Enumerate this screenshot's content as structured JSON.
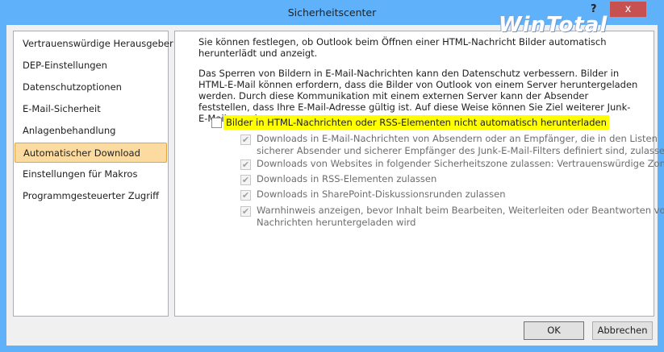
{
  "window": {
    "title": "Sicherheitscenter",
    "help": "?",
    "close": "x",
    "watermark": "WinTotal"
  },
  "sidebar": {
    "items": [
      "Vertrauenswürdige Herausgeber",
      "DEP-Einstellungen",
      "Datenschutzoptionen",
      "E-Mail-Sicherheit",
      "Anlagenbehandlung",
      "Automatischer Download",
      "Einstellungen für Makros",
      "Programmgesteuerter Zugriff"
    ],
    "selected": "Automatischer Download"
  },
  "main": {
    "intro": "Sie können festlegen, ob Outlook beim Öffnen einer HTML-Nachricht Bilder automatisch herunterlädt und anzeigt.",
    "info": "Das Sperren von Bildern in E-Mail-Nachrichten kann den Datenschutz verbessern. Bilder in HTML-E-Mail können erfordern, dass die Bilder von Outlook von einem Server heruntergeladen werden. Durch diese Kommunikation mit einem externen Server kann der Absender feststellen, dass Ihre E-Mail-Adresse gültig ist. Auf diese Weise können Sie Ziel weiterer Junk-E-Mails werden.",
    "main_option": {
      "label": "Bilder in HTML-Nachrichten oder RSS-Elementen nicht automatisch herunterladen",
      "checked": false
    },
    "sub_options": [
      {
        "line1": "Downloads in E-Mail-Nachrichten von Absendern oder an Empfänger, die in den Listen",
        "line2": "sicherer Absender und sicherer Empfänger des Junk-E-Mail-Filters definiert sind, zulassen",
        "checked": true
      },
      {
        "line1": "Downloads von Websites in folgender Sicherheitszone zulassen: Vertrauenswürdige Zone",
        "checked": true
      },
      {
        "line1": "Downloads in RSS-Elementen zulassen",
        "checked": true
      },
      {
        "line1": "Downloads in SharePoint-Diskussionsrunden zulassen",
        "checked": true
      },
      {
        "line1": "Warnhinweis anzeigen, bevor Inhalt beim Bearbeiten, Weiterleiten oder Beantworten von",
        "line2": "Nachrichten heruntergeladen wird",
        "checked": true
      }
    ]
  },
  "buttons": {
    "ok": "OK",
    "cancel": "Abbrechen"
  }
}
